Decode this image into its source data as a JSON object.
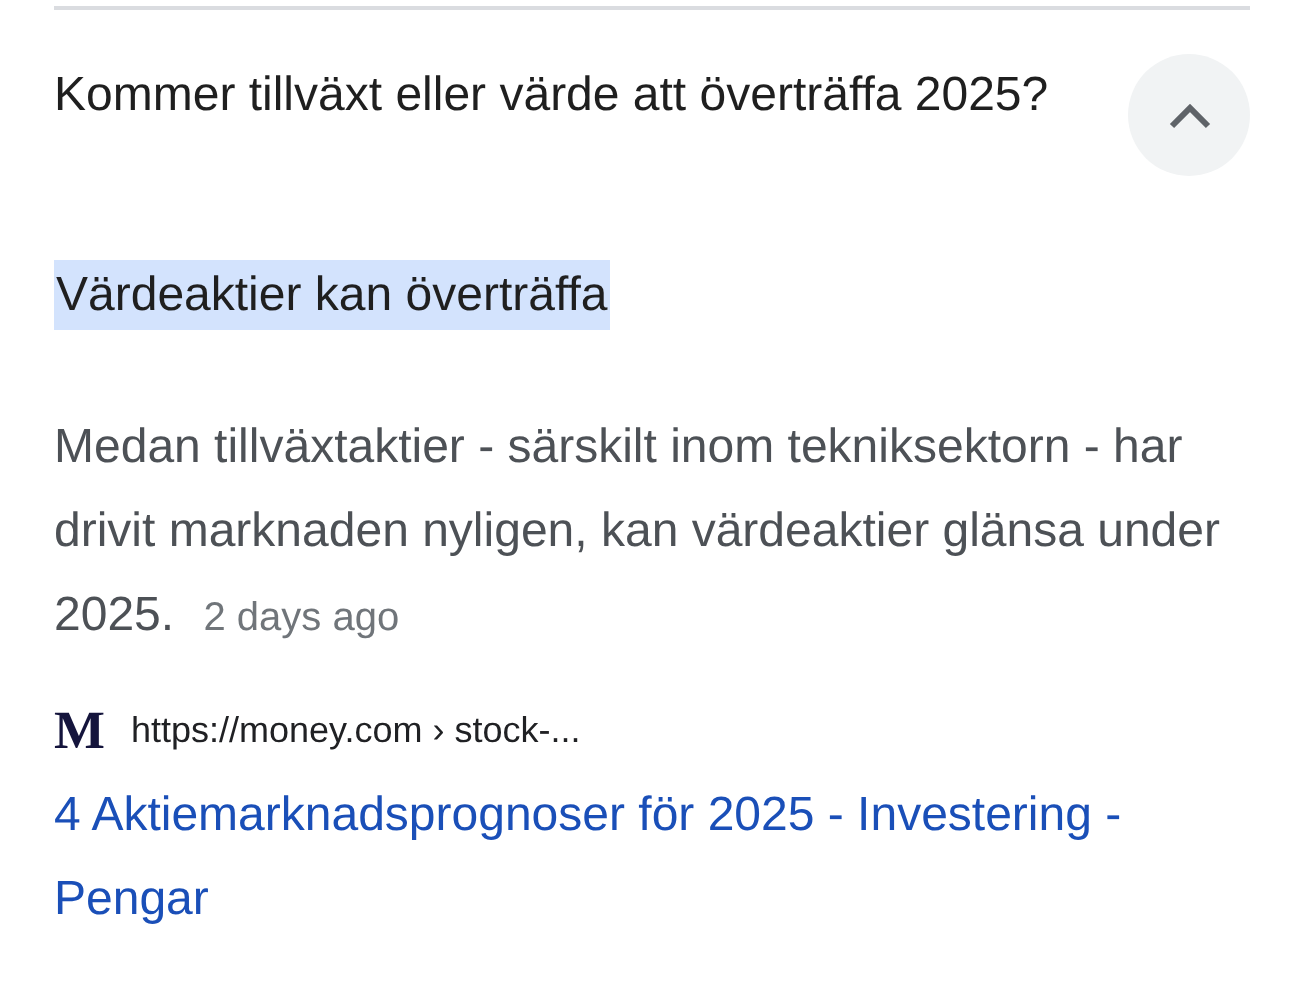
{
  "question": {
    "text": "Kommer tillväxt eller värde att överträffa 2025?",
    "expanded": true
  },
  "answer": {
    "heading": "Värdeaktier kan överträffa",
    "highlighted": true,
    "snippet": "Medan tillväxtaktier - särskilt inom tekniksektorn - har drivit marknaden nyligen, kan värdeaktier glänsa under 2025.",
    "date": "2 days ago"
  },
  "source": {
    "favicon": "M",
    "url": "https://money.com › stock-...",
    "title": "4 Aktiemarknadsprognoser för 2025 - Investering - Pengar"
  }
}
